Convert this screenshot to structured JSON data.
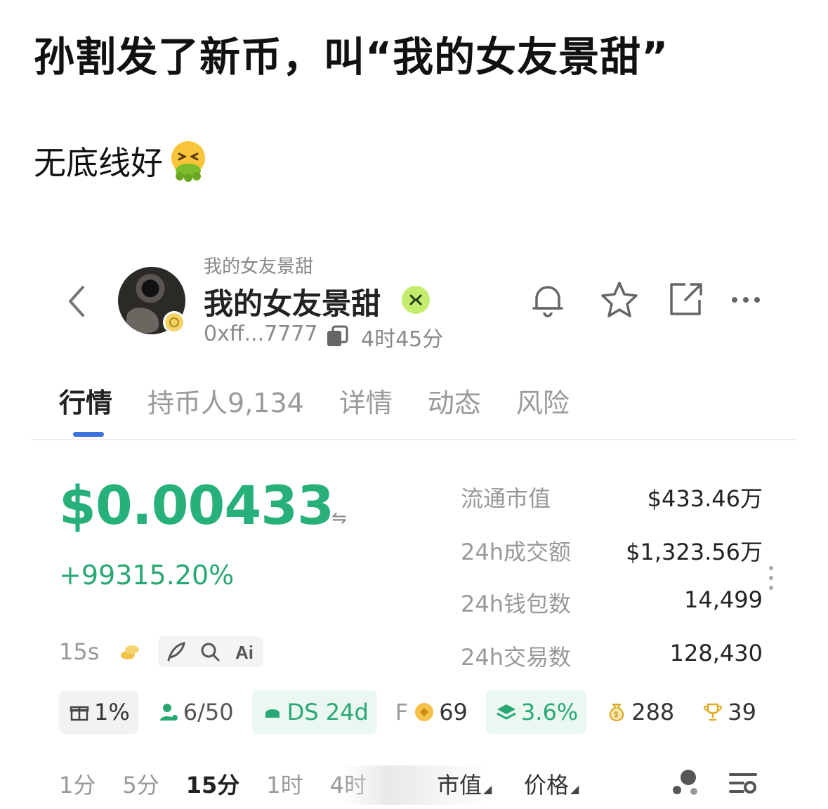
{
  "post": {
    "title": "孙割发了新币，叫“我的女友景甜”",
    "body": "无底线好",
    "emoji": "nauseated-vomiting-face"
  },
  "token": {
    "subname": "我的女友景甜",
    "name": "我的女友景甜",
    "address": "0xff...7777",
    "age": "4时45分"
  },
  "header_icons": [
    "bell-icon",
    "star-icon",
    "share-icon",
    "more-icon"
  ],
  "tabs": [
    {
      "label": "行情",
      "active": true
    },
    {
      "label": "持币人9,134"
    },
    {
      "label": "详情"
    },
    {
      "label": "动态"
    },
    {
      "label": "风险"
    }
  ],
  "price": {
    "value": "$0.00433",
    "change": "+99315.20%",
    "color": "#27b07a"
  },
  "quick": {
    "interval": "15s"
  },
  "stats": [
    {
      "label": "流通市值",
      "value": "$433.46万"
    },
    {
      "label": "24h成交额",
      "value": "$1,323.56万"
    },
    {
      "label": "24h钱包数",
      "value": "14,499"
    },
    {
      "label": "24h交易数",
      "value": "128,430"
    }
  ],
  "badges": [
    {
      "icon": "gift-icon",
      "text": "1%"
    },
    {
      "icon": "user-icon",
      "text": "6/50"
    },
    {
      "icon": "ds-icon",
      "text": "DS 24d"
    },
    {
      "icon": "coin-icon",
      "prefix": "F",
      "text": "69"
    },
    {
      "icon": "layers-icon",
      "text": "3.6%"
    },
    {
      "icon": "money-bag-icon",
      "text": "288"
    },
    {
      "icon": "trophy-icon",
      "text": "39"
    }
  ],
  "timeframes": [
    "1分",
    "5分",
    "15分",
    "1时",
    "4时"
  ],
  "active_timeframe": "15分",
  "dropdowns": {
    "mode": "市值",
    "type": "价格"
  },
  "colors": {
    "accent_green": "#27b07a",
    "tab_indicator": "#3c72d9"
  }
}
